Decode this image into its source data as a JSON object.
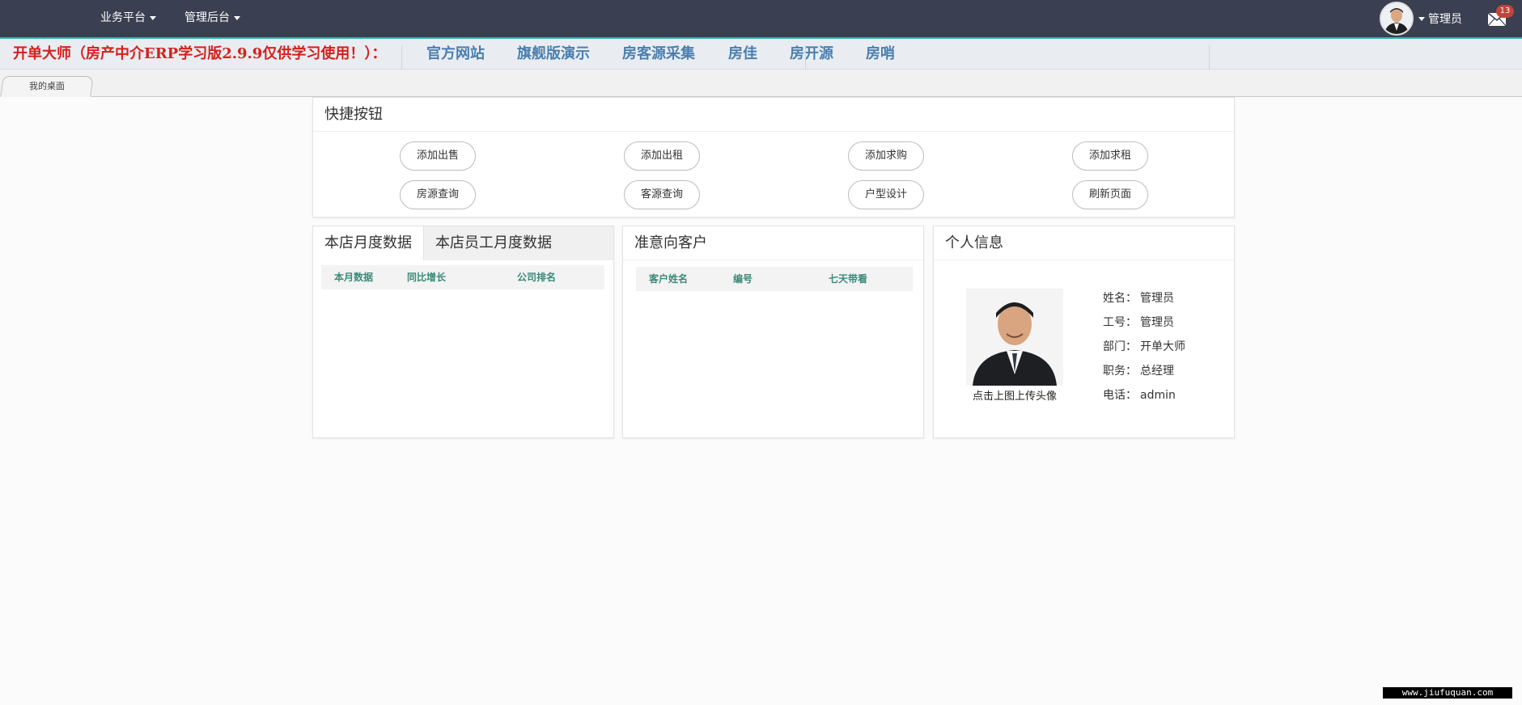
{
  "topbar": {
    "menus": [
      {
        "label": "业务平台"
      },
      {
        "label": "管理后台"
      }
    ],
    "user_name": "管理员",
    "mail_badge": "13"
  },
  "banner": {
    "title": "开单大师（房产中介ERP学习版2.9.9仅供学习使用！）：",
    "links": [
      "官方网站",
      "旗舰版演示",
      "房客源采集",
      "房佳",
      "房开源",
      "房哨"
    ]
  },
  "tabs": {
    "desktop": "我的桌面"
  },
  "quick_buttons": {
    "title": "快捷按钮",
    "row1": [
      "添加出售",
      "添加出租",
      "添加求购",
      "添加求租"
    ],
    "row2": [
      "房源查询",
      "客源查询",
      "户型设计",
      "刷新页面"
    ]
  },
  "monthly": {
    "tabs": [
      "本店月度数据",
      "本店员工月度数据"
    ],
    "columns": [
      "本月数据",
      "同比增长",
      "公司排名"
    ]
  },
  "customers": {
    "title": "准意向客户",
    "columns": [
      "客户姓名",
      "编号",
      "七天带看"
    ]
  },
  "profile": {
    "title": "个人信息",
    "photo_caption": "点击上图上传头像",
    "fields": [
      {
        "k": "姓名：",
        "v": "管理员"
      },
      {
        "k": "工号：",
        "v": "管理员"
      },
      {
        "k": "部门：",
        "v": "开单大师"
      },
      {
        "k": "职务：",
        "v": "总经理"
      },
      {
        "k": "电话：",
        "v": "admin"
      }
    ]
  },
  "watermark": "www.jiufuquan.com",
  "colors": {
    "topbar": "#3a3f51",
    "accent_line": "#2fb1b1",
    "banner_red": "#d6201c",
    "banner_link": "#4a7fb0",
    "table_header_text": "#3a8a7a"
  }
}
